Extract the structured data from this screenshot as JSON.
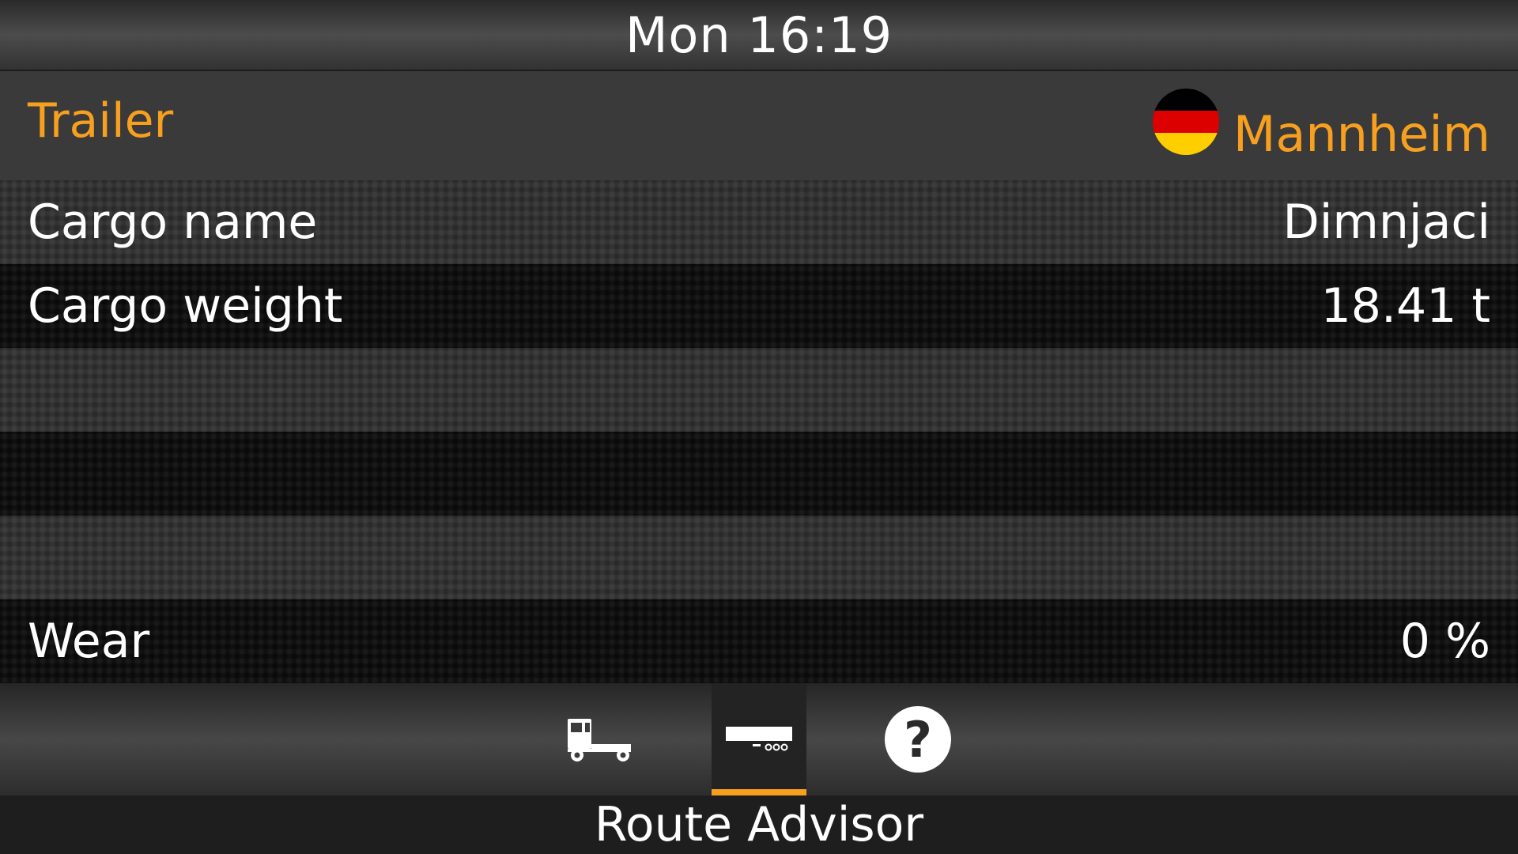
{
  "topbar": {
    "clock": "Mon 16:19"
  },
  "header": {
    "title": "Trailer",
    "destination_city": "Mannheim",
    "flag_icon": "germany-flag-icon",
    "flag_colors": [
      "#000000",
      "#dd0000",
      "#ffce00"
    ],
    "accent_color": "#f7a01f"
  },
  "rows": [
    {
      "label": "Cargo name",
      "value": "Dimnjaci"
    },
    {
      "label": "Cargo weight",
      "value": "18.41 t"
    },
    {
      "label": "",
      "value": ""
    },
    {
      "label": "",
      "value": ""
    },
    {
      "label": "",
      "value": ""
    },
    {
      "label": "Wear",
      "value": "0 %"
    }
  ],
  "toolbar": {
    "tabs": [
      {
        "icon": "truck-icon",
        "active": false
      },
      {
        "icon": "trailer-icon",
        "active": true
      },
      {
        "icon": "help-icon",
        "active": false
      }
    ],
    "help_glyph": "?"
  },
  "footer": {
    "title": "Route Advisor"
  }
}
